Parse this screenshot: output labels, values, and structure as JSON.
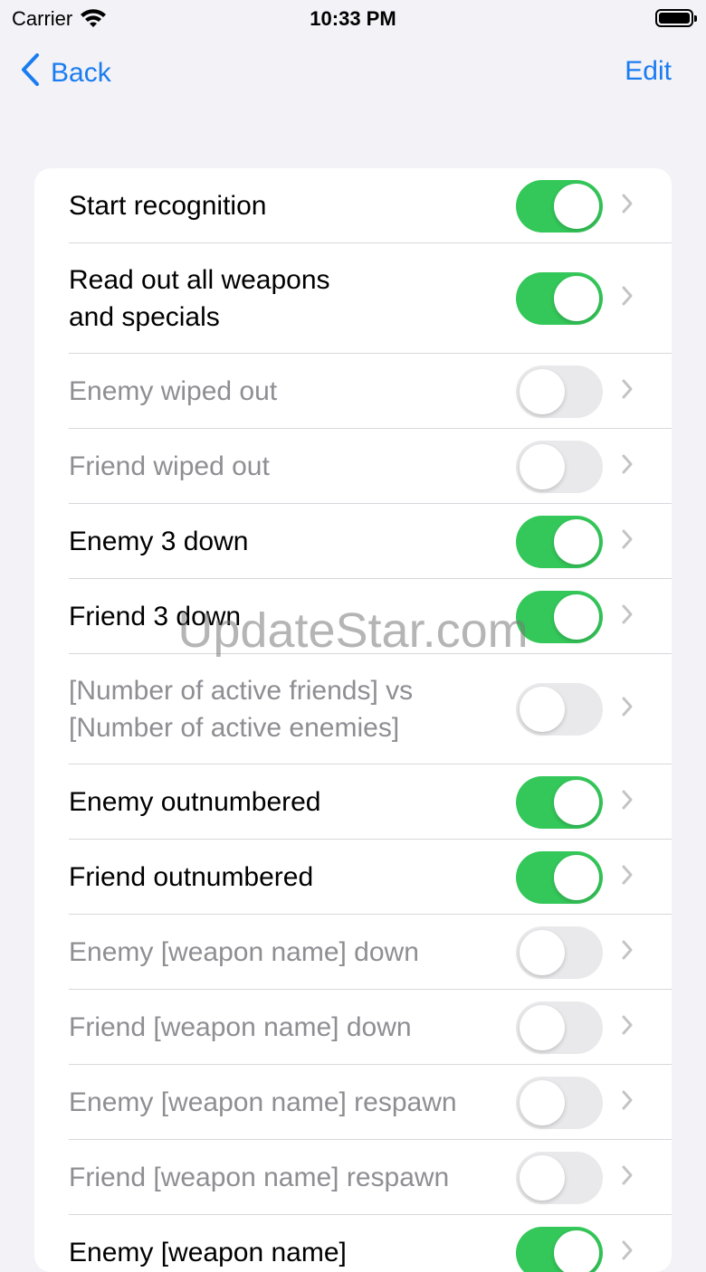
{
  "status": {
    "carrier": "Carrier",
    "time": "10:33 PM"
  },
  "nav": {
    "back": "Back",
    "edit": "Edit"
  },
  "rows": [
    {
      "label": "Start recognition",
      "on": true,
      "enabled": true
    },
    {
      "label": "Read out all weapons\nand specials",
      "on": true,
      "enabled": true
    },
    {
      "label": "Enemy wiped out",
      "on": false,
      "enabled": false
    },
    {
      "label": "Friend wiped out",
      "on": false,
      "enabled": false
    },
    {
      "label": "Enemy 3 down",
      "on": true,
      "enabled": true
    },
    {
      "label": "Friend 3 down",
      "on": true,
      "enabled": true
    },
    {
      "label": "[Number of active friends] vs\n[Number of active enemies]",
      "on": false,
      "enabled": false
    },
    {
      "label": "Enemy outnumbered",
      "on": true,
      "enabled": true
    },
    {
      "label": "Friend outnumbered",
      "on": true,
      "enabled": true
    },
    {
      "label": "Enemy [weapon name] down",
      "on": false,
      "enabled": false
    },
    {
      "label": "Friend [weapon name] down",
      "on": false,
      "enabled": false
    },
    {
      "label": "Enemy [weapon name] respawn",
      "on": false,
      "enabled": false
    },
    {
      "label": "Friend [weapon name] respawn",
      "on": false,
      "enabled": false
    },
    {
      "label": "Enemy [weapon name]",
      "on": true,
      "enabled": true
    }
  ],
  "watermark": "UpdateStar.com"
}
